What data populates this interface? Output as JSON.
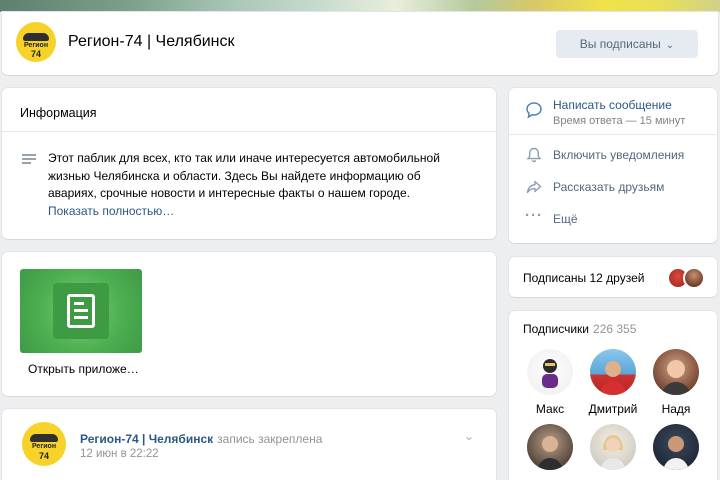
{
  "header": {
    "group_name": "Регион-74 | Челябинск",
    "logo_text": "Регион",
    "logo_number": "74",
    "subscribe_button": "Вы подписаны",
    "subscribe_chevron": "⌄"
  },
  "info": {
    "title": "Информация",
    "description": "Этот паблик для всех, кто так или иначе интересуется автомобильной жизнью Челябинска и области. Здесь Вы найдете информацию об авариях, срочные новости и интересные факты о нашем городе.",
    "show_more": "Показать полностью…"
  },
  "actions": {
    "message": {
      "label": "Написать сообщение",
      "sublabel": "Время ответа — 15 минут",
      "icon": "message-icon"
    },
    "notify": {
      "label": "Включить уведомления",
      "icon": "bell-icon"
    },
    "share": {
      "label": "Рассказать друзьям",
      "icon": "share-icon"
    },
    "more": {
      "label": "Ещё",
      "icon": "more-icon"
    }
  },
  "friends": {
    "label": "Подписаны 12 друзей"
  },
  "app": {
    "label": "Открыть приложе…"
  },
  "followers": {
    "title": "Подписчики",
    "count": "226 355",
    "items": [
      {
        "name": "Макс"
      },
      {
        "name": "Дмитрий"
      },
      {
        "name": "Надя"
      },
      {
        "name": ""
      },
      {
        "name": ""
      },
      {
        "name": ""
      }
    ]
  },
  "post": {
    "author": "Регион-74 | Челябинск",
    "pinned_note": "запись закреплена",
    "date": "12 июн в 22:22",
    "chevron": "⌄"
  },
  "colors": {
    "link": "#2a5885",
    "button_bg": "#e5ebf1",
    "logo_yellow": "#f7d329",
    "app_green": "#4caf50"
  }
}
